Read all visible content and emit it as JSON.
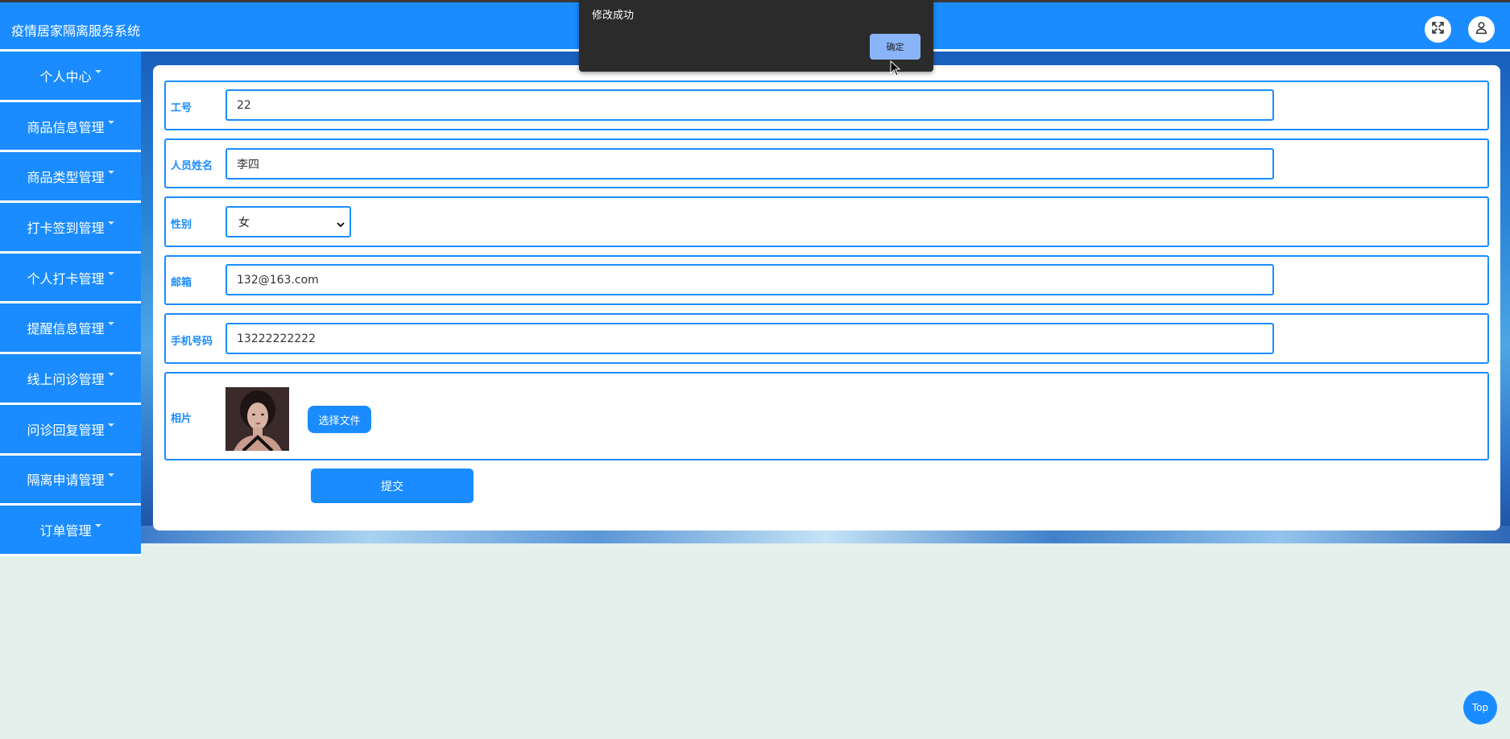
{
  "header": {
    "app_title": "疫情居家隔离服务系统",
    "fullscreen_icon": "expand-icon",
    "user_icon": "user-icon"
  },
  "sidebar": {
    "items": [
      {
        "label": "个人中心"
      },
      {
        "label": "商品信息管理"
      },
      {
        "label": "商品类型管理"
      },
      {
        "label": "打卡签到管理"
      },
      {
        "label": "个人打卡管理"
      },
      {
        "label": "提醒信息管理"
      },
      {
        "label": "线上问诊管理"
      },
      {
        "label": "问诊回复管理"
      },
      {
        "label": "隔离申请管理"
      },
      {
        "label": "订单管理"
      }
    ]
  },
  "form": {
    "employee_id": {
      "label": "工号",
      "value": "22"
    },
    "name": {
      "label": "人员姓名",
      "value": "李四"
    },
    "gender": {
      "label": "性别",
      "value": "女"
    },
    "email": {
      "label": "邮箱",
      "value": "132@163.com"
    },
    "phone": {
      "label": "手机号码",
      "value": "13222222222"
    },
    "photo": {
      "label": "相片",
      "choose_label": "选择文件"
    },
    "submit_label": "提交"
  },
  "dialog": {
    "message": "修改成功",
    "ok_label": "确定"
  },
  "top_button": {
    "label": "Top"
  },
  "colors": {
    "primary": "#1a8cff",
    "page_bg": "#e3f0ec",
    "dialog_bg": "#2b2b2b",
    "dialog_button": "#8ab4f8"
  }
}
